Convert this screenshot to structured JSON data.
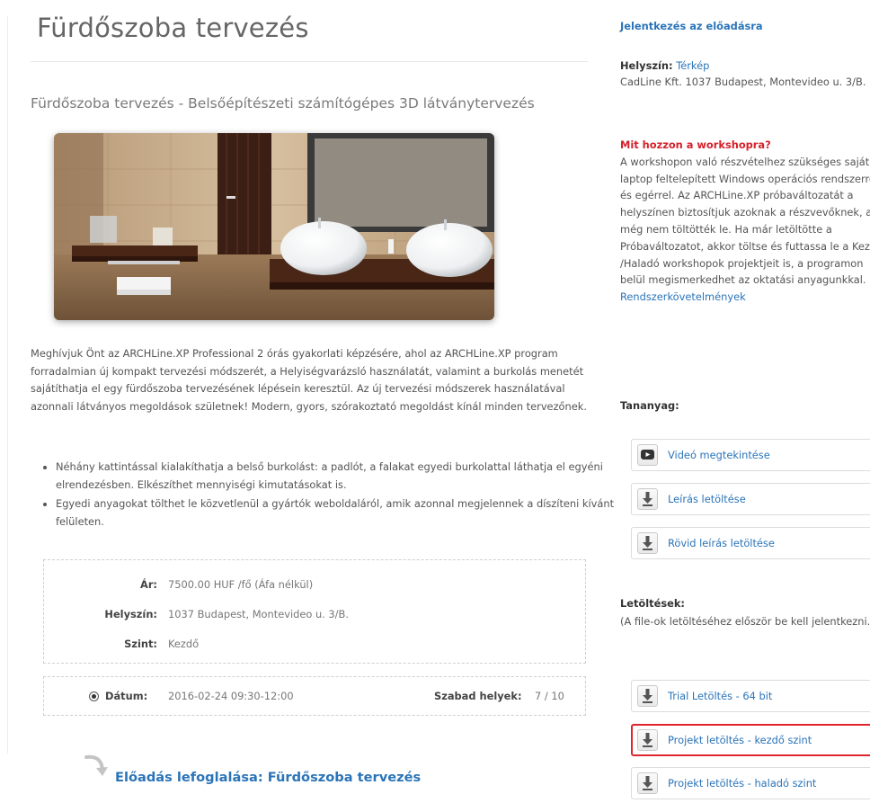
{
  "page": {
    "title": "Fürdőszoba tervezés",
    "subtitle": "Fürdőszoba tervezés - Belsőépítészeti számítógépes 3D látványtervezés",
    "intro": "Meghívjuk Önt az ARCHLine.XP Professional 2 órás gyakorlati képzésére, ahol az ARCHLine.XP program forradalmian új kompakt tervezési módszerét, a Helyiségvarázsló használatát, valamint a burkolás menetét sajátíthatja el egy fürdőszoba tervezésének lépésein keresztül. Az új tervezési módszerek használatával azonnali látványos megoldások születnek! Modern, gyors, szórakoztató megoldást kínál minden tervezőnek.",
    "bullets": [
      "Néhány kattintással kialakíthatja a belső burkolást: a padlót, a falakat egyedi burkolattal láthatja el egyéni elrendezésben. Elkészíthet mennyiségi kimutatásokat is.",
      "Egyedi anyagokat tölthet le közvetlenül a gyártók weboldaláról, amik azonnal megjelennek a díszíteni kívánt felületen."
    ],
    "info": [
      {
        "label": "Ár:",
        "value": "7500.00 HUF /fő (Áfa nélkül)"
      },
      {
        "label": "Helyszín:",
        "value": "1037 Budapest, Montevideo u. 3/B."
      },
      {
        "label": "Szint:",
        "value": "Kezdő"
      }
    ],
    "date": {
      "label": "Dátum:",
      "value": "2016-02-24 09:30-12:00",
      "free_label": "Szabad helyek:",
      "free_value": "7 / 10"
    },
    "booking_link": "Előadás lefoglalása: Fürdőszoba tervezés"
  },
  "sidebar": {
    "register_link": "Jelentkezés az előadásra",
    "venue_label": "Helyszín:",
    "venue_map_link": "Térkép",
    "venue_address": "CadLine Kft. 1037 Budapest, Montevideo u. 3/B.",
    "bring_heading": "Mit hozzon a workshopra?",
    "bring_text": "A workshopon való részvételhez szükséges saját laptop feltelepített Windows operációs rendszerrel és egérrel. Az ARCHLine.XP próbaváltozatát a helyszínen biztosítjuk azoknak a részvevőknek, akik még nem töltötték le. Ha már letöltötte a Próbaváltozatot, akkor töltse és futtassa le a Kezdő /Haladó workshopok projektjeit is, a programon belül megismerkedhet az oktatási anyagunkkal.",
    "requirements_link": "Rendszerkövetelmények",
    "material_heading": "Tananyag:",
    "material_buttons": [
      {
        "label": "Videó megtekintése",
        "icon": "video-play-icon"
      },
      {
        "label": "Leírás letöltése",
        "icon": "download-icon"
      },
      {
        "label": "Rövid leírás letöltése",
        "icon": "download-icon"
      }
    ],
    "downloads_heading": "Letöltések:",
    "downloads_note": "(A file-ok letöltéséhez először be kell jelentkezni.)",
    "download_buttons": [
      {
        "label": "Trial Letöltés - 64 bit",
        "icon": "download-icon",
        "highlighted": false
      },
      {
        "label": "Projekt letöltés - kezdő szint",
        "icon": "download-icon",
        "highlighted": true
      },
      {
        "label": "Projekt letöltés - haladó szint",
        "icon": "download-icon",
        "highlighted": false
      }
    ]
  },
  "colors": {
    "link": "#2a74b8",
    "alert": "#d5202a",
    "highlight_border": "#e0242c"
  }
}
